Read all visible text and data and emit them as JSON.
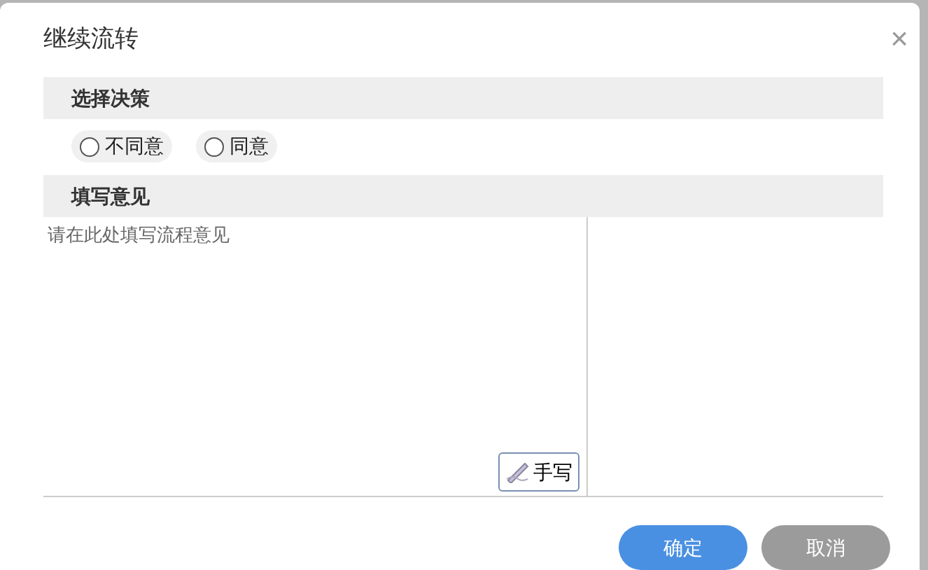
{
  "dialog": {
    "title": "继续流转",
    "close": "×"
  },
  "decision": {
    "heading": "选择决策",
    "options": [
      {
        "label": "不同意",
        "selected": false
      },
      {
        "label": "同意",
        "selected": false
      }
    ]
  },
  "opinion": {
    "heading": "填写意见",
    "placeholder": "请在此处填写流程意见",
    "handwrite_button": "手写"
  },
  "buttons": [
    {
      "label": "确定",
      "kind": "primary"
    },
    {
      "label": "取消",
      "kind": "secondary"
    }
  ]
}
